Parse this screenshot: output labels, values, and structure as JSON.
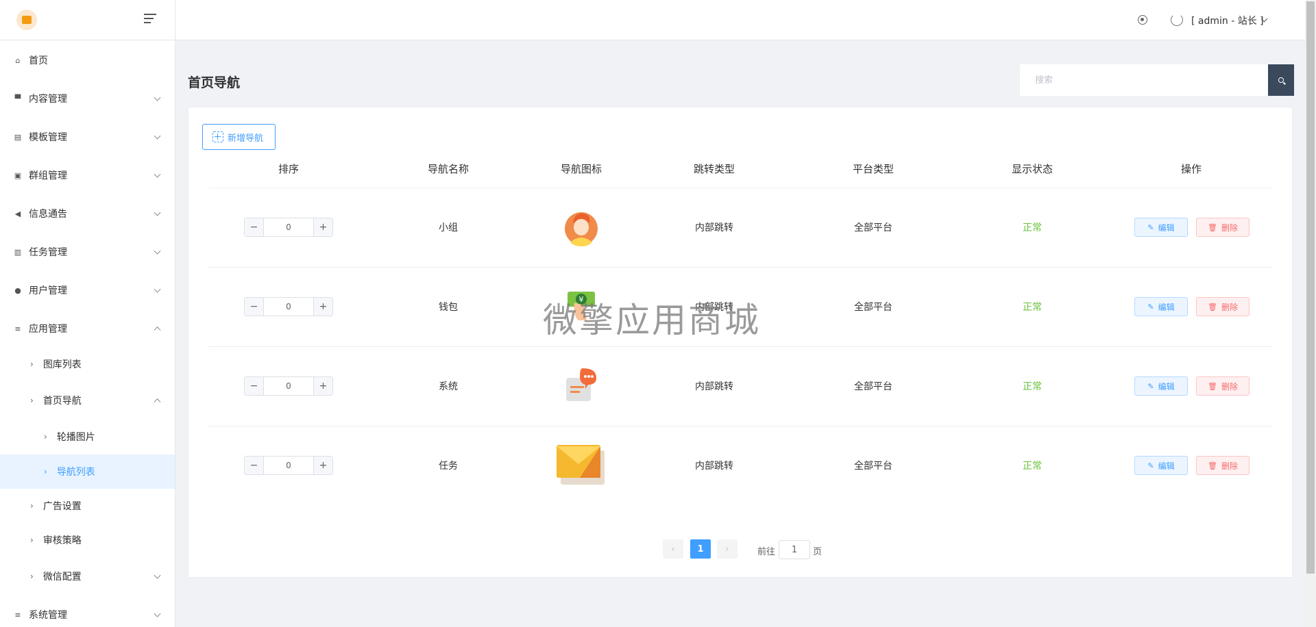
{
  "sidebar": {
    "items": [
      {
        "label": "首页",
        "icon": "home-icon"
      },
      {
        "label": "内容管理",
        "icon": "comment-icon"
      },
      {
        "label": "模板管理",
        "icon": "template-icon"
      },
      {
        "label": "群组管理",
        "icon": "group-icon"
      },
      {
        "label": "信息通告",
        "icon": "megaphone-icon"
      },
      {
        "label": "任务管理",
        "icon": "task-icon"
      },
      {
        "label": "用户管理",
        "icon": "users-icon"
      },
      {
        "label": "应用管理",
        "icon": "sliders-icon"
      },
      {
        "label": "图库列表"
      },
      {
        "label": "首页导航"
      },
      {
        "label": "轮播图片"
      },
      {
        "label": "导航列表"
      },
      {
        "label": "广告设置"
      },
      {
        "label": "审核策略"
      },
      {
        "label": "微信配置"
      },
      {
        "label": "系统管理",
        "icon": "system-icon"
      }
    ]
  },
  "header": {
    "user": "[ admin - 站长 ]"
  },
  "page": {
    "title": "首页导航",
    "search_placeholder": "搜索",
    "add_button": "新增导航"
  },
  "table": {
    "columns": [
      "排序",
      "导航名称",
      "导航图标",
      "跳转类型",
      "平台类型",
      "显示状态",
      "操作"
    ],
    "rows": [
      {
        "order": "0",
        "name": "小组",
        "icon": "person-avatar-icon",
        "jump_type": "内部跳转",
        "platform": "全部平台",
        "status": "正常",
        "edit": "编辑",
        "delete": "删除"
      },
      {
        "order": "0",
        "name": "钱包",
        "icon": "wallet-money-icon",
        "jump_type": "内部跳转",
        "platform": "全部平台",
        "status": "正常",
        "edit": "编辑",
        "delete": "删除"
      },
      {
        "order": "0",
        "name": "系统",
        "icon": "message-bubble-icon",
        "jump_type": "内部跳转",
        "platform": "全部平台",
        "status": "正常",
        "edit": "编辑",
        "delete": "删除"
      },
      {
        "order": "0",
        "name": "任务",
        "icon": "envelope-icon",
        "jump_type": "内部跳转",
        "platform": "全部平台",
        "status": "正常",
        "edit": "编辑",
        "delete": "删除"
      }
    ]
  },
  "pagination": {
    "current": "1",
    "goto_prefix": "前往",
    "goto_value": "1",
    "goto_suffix": "页"
  },
  "watermark": "微擎应用商城",
  "colors": {
    "accent": "#409eff",
    "status_ok": "#67c23a",
    "danger": "#f56c6c",
    "search_button": "#3a4a5c"
  }
}
